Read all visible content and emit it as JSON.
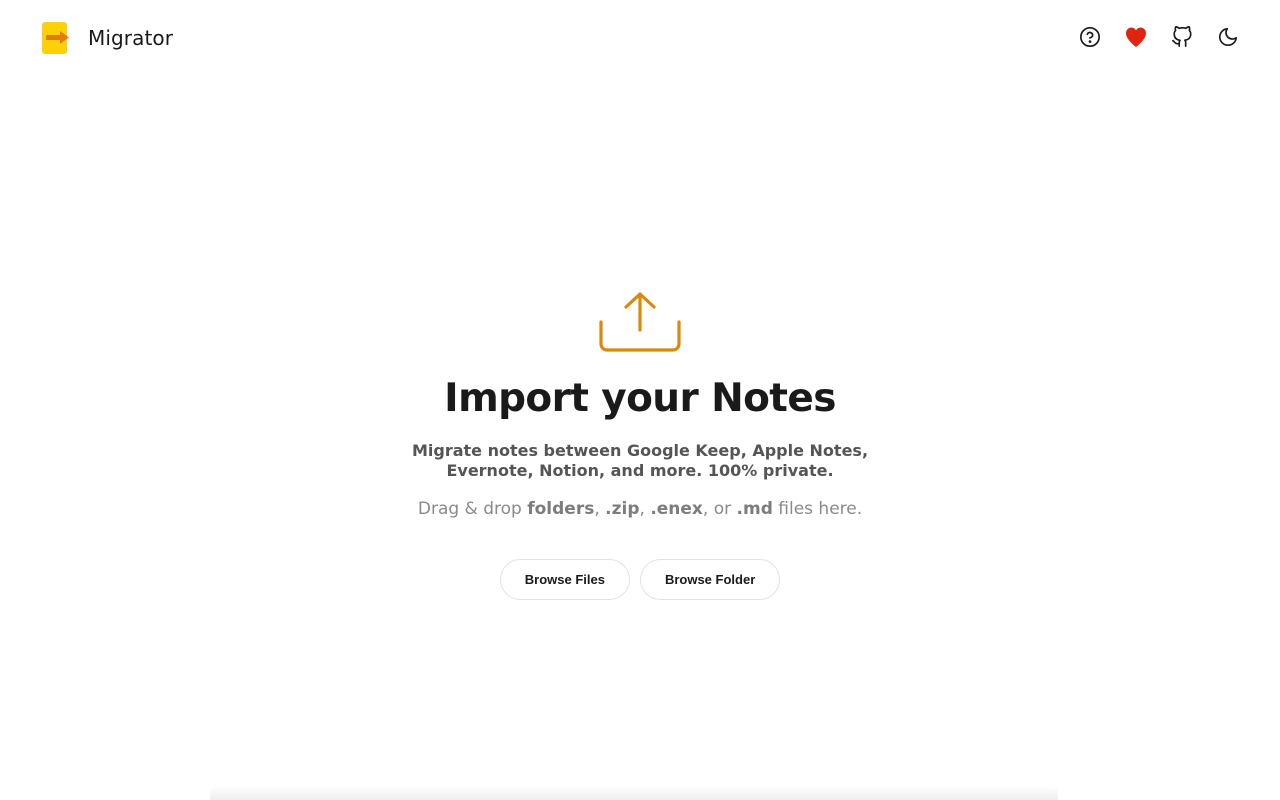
{
  "header": {
    "app_name": "Migrator",
    "logo_icon": "migrator-logo-icon",
    "actions": [
      {
        "name": "help-icon"
      },
      {
        "name": "heart-icon",
        "color": "#e02410"
      },
      {
        "name": "github-icon"
      },
      {
        "name": "moon-icon"
      }
    ]
  },
  "main": {
    "upload_icon": "upload-icon",
    "upload_icon_color": "#d98a0b",
    "title": "Import your Notes",
    "subtitle": "Migrate notes between Google Keep, Apple Notes, Evernote, Notion, and more. 100% private.",
    "drop_hint": {
      "prefix": "Drag & drop ",
      "folders": "folders",
      "sep1": ", ",
      "zip": ".zip",
      "sep2": ", ",
      "enex": ".enex",
      "sep3": ", or ",
      "md": ".md",
      "suffix": " files here."
    },
    "browse_files_label": "Browse Files",
    "browse_folder_label": "Browse Folder"
  },
  "colors": {
    "logo_yellow": "#fcd10a",
    "logo_arrow": "#e37a12",
    "accent": "#d98a0b"
  }
}
